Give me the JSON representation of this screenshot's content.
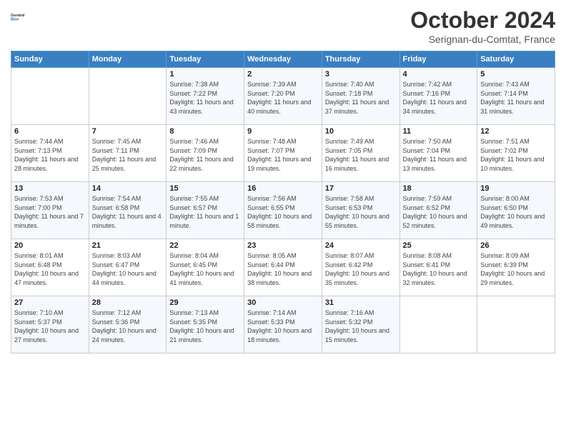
{
  "header": {
    "logo_line1": "General",
    "logo_line2": "Blue",
    "title": "October 2024",
    "subtitle": "Serignan-du-Comtat, France"
  },
  "days_of_week": [
    "Sunday",
    "Monday",
    "Tuesday",
    "Wednesday",
    "Thursday",
    "Friday",
    "Saturday"
  ],
  "weeks": [
    [
      {
        "num": "",
        "sunrise": "",
        "sunset": "",
        "daylight": ""
      },
      {
        "num": "",
        "sunrise": "",
        "sunset": "",
        "daylight": ""
      },
      {
        "num": "1",
        "sunrise": "Sunrise: 7:38 AM",
        "sunset": "Sunset: 7:22 PM",
        "daylight": "Daylight: 11 hours and 43 minutes."
      },
      {
        "num": "2",
        "sunrise": "Sunrise: 7:39 AM",
        "sunset": "Sunset: 7:20 PM",
        "daylight": "Daylight: 11 hours and 40 minutes."
      },
      {
        "num": "3",
        "sunrise": "Sunrise: 7:40 AM",
        "sunset": "Sunset: 7:18 PM",
        "daylight": "Daylight: 11 hours and 37 minutes."
      },
      {
        "num": "4",
        "sunrise": "Sunrise: 7:42 AM",
        "sunset": "Sunset: 7:16 PM",
        "daylight": "Daylight: 11 hours and 34 minutes."
      },
      {
        "num": "5",
        "sunrise": "Sunrise: 7:43 AM",
        "sunset": "Sunset: 7:14 PM",
        "daylight": "Daylight: 11 hours and 31 minutes."
      }
    ],
    [
      {
        "num": "6",
        "sunrise": "Sunrise: 7:44 AM",
        "sunset": "Sunset: 7:13 PM",
        "daylight": "Daylight: 11 hours and 28 minutes."
      },
      {
        "num": "7",
        "sunrise": "Sunrise: 7:45 AM",
        "sunset": "Sunset: 7:11 PM",
        "daylight": "Daylight: 11 hours and 25 minutes."
      },
      {
        "num": "8",
        "sunrise": "Sunrise: 7:46 AM",
        "sunset": "Sunset: 7:09 PM",
        "daylight": "Daylight: 11 hours and 22 minutes."
      },
      {
        "num": "9",
        "sunrise": "Sunrise: 7:48 AM",
        "sunset": "Sunset: 7:07 PM",
        "daylight": "Daylight: 11 hours and 19 minutes."
      },
      {
        "num": "10",
        "sunrise": "Sunrise: 7:49 AM",
        "sunset": "Sunset: 7:05 PM",
        "daylight": "Daylight: 11 hours and 16 minutes."
      },
      {
        "num": "11",
        "sunrise": "Sunrise: 7:50 AM",
        "sunset": "Sunset: 7:04 PM",
        "daylight": "Daylight: 11 hours and 13 minutes."
      },
      {
        "num": "12",
        "sunrise": "Sunrise: 7:51 AM",
        "sunset": "Sunset: 7:02 PM",
        "daylight": "Daylight: 11 hours and 10 minutes."
      }
    ],
    [
      {
        "num": "13",
        "sunrise": "Sunrise: 7:53 AM",
        "sunset": "Sunset: 7:00 PM",
        "daylight": "Daylight: 11 hours and 7 minutes."
      },
      {
        "num": "14",
        "sunrise": "Sunrise: 7:54 AM",
        "sunset": "Sunset: 6:58 PM",
        "daylight": "Daylight: 11 hours and 4 minutes."
      },
      {
        "num": "15",
        "sunrise": "Sunrise: 7:55 AM",
        "sunset": "Sunset: 6:57 PM",
        "daylight": "Daylight: 11 hours and 1 minute."
      },
      {
        "num": "16",
        "sunrise": "Sunrise: 7:56 AM",
        "sunset": "Sunset: 6:55 PM",
        "daylight": "Daylight: 10 hours and 58 minutes."
      },
      {
        "num": "17",
        "sunrise": "Sunrise: 7:58 AM",
        "sunset": "Sunset: 6:53 PM",
        "daylight": "Daylight: 10 hours and 55 minutes."
      },
      {
        "num": "18",
        "sunrise": "Sunrise: 7:59 AM",
        "sunset": "Sunset: 6:52 PM",
        "daylight": "Daylight: 10 hours and 52 minutes."
      },
      {
        "num": "19",
        "sunrise": "Sunrise: 8:00 AM",
        "sunset": "Sunset: 6:50 PM",
        "daylight": "Daylight: 10 hours and 49 minutes."
      }
    ],
    [
      {
        "num": "20",
        "sunrise": "Sunrise: 8:01 AM",
        "sunset": "Sunset: 6:48 PM",
        "daylight": "Daylight: 10 hours and 47 minutes."
      },
      {
        "num": "21",
        "sunrise": "Sunrise: 8:03 AM",
        "sunset": "Sunset: 6:47 PM",
        "daylight": "Daylight: 10 hours and 44 minutes."
      },
      {
        "num": "22",
        "sunrise": "Sunrise: 8:04 AM",
        "sunset": "Sunset: 6:45 PM",
        "daylight": "Daylight: 10 hours and 41 minutes."
      },
      {
        "num": "23",
        "sunrise": "Sunrise: 8:05 AM",
        "sunset": "Sunset: 6:44 PM",
        "daylight": "Daylight: 10 hours and 38 minutes."
      },
      {
        "num": "24",
        "sunrise": "Sunrise: 8:07 AM",
        "sunset": "Sunset: 6:42 PM",
        "daylight": "Daylight: 10 hours and 35 minutes."
      },
      {
        "num": "25",
        "sunrise": "Sunrise: 8:08 AM",
        "sunset": "Sunset: 6:41 PM",
        "daylight": "Daylight: 10 hours and 32 minutes."
      },
      {
        "num": "26",
        "sunrise": "Sunrise: 8:09 AM",
        "sunset": "Sunset: 6:39 PM",
        "daylight": "Daylight: 10 hours and 29 minutes."
      }
    ],
    [
      {
        "num": "27",
        "sunrise": "Sunrise: 7:10 AM",
        "sunset": "Sunset: 5:37 PM",
        "daylight": "Daylight: 10 hours and 27 minutes."
      },
      {
        "num": "28",
        "sunrise": "Sunrise: 7:12 AM",
        "sunset": "Sunset: 5:36 PM",
        "daylight": "Daylight: 10 hours and 24 minutes."
      },
      {
        "num": "29",
        "sunrise": "Sunrise: 7:13 AM",
        "sunset": "Sunset: 5:35 PM",
        "daylight": "Daylight: 10 hours and 21 minutes."
      },
      {
        "num": "30",
        "sunrise": "Sunrise: 7:14 AM",
        "sunset": "Sunset: 5:33 PM",
        "daylight": "Daylight: 10 hours and 18 minutes."
      },
      {
        "num": "31",
        "sunrise": "Sunrise: 7:16 AM",
        "sunset": "Sunset: 5:32 PM",
        "daylight": "Daylight: 10 hours and 15 minutes."
      },
      {
        "num": "",
        "sunrise": "",
        "sunset": "",
        "daylight": ""
      },
      {
        "num": "",
        "sunrise": "",
        "sunset": "",
        "daylight": ""
      }
    ]
  ]
}
